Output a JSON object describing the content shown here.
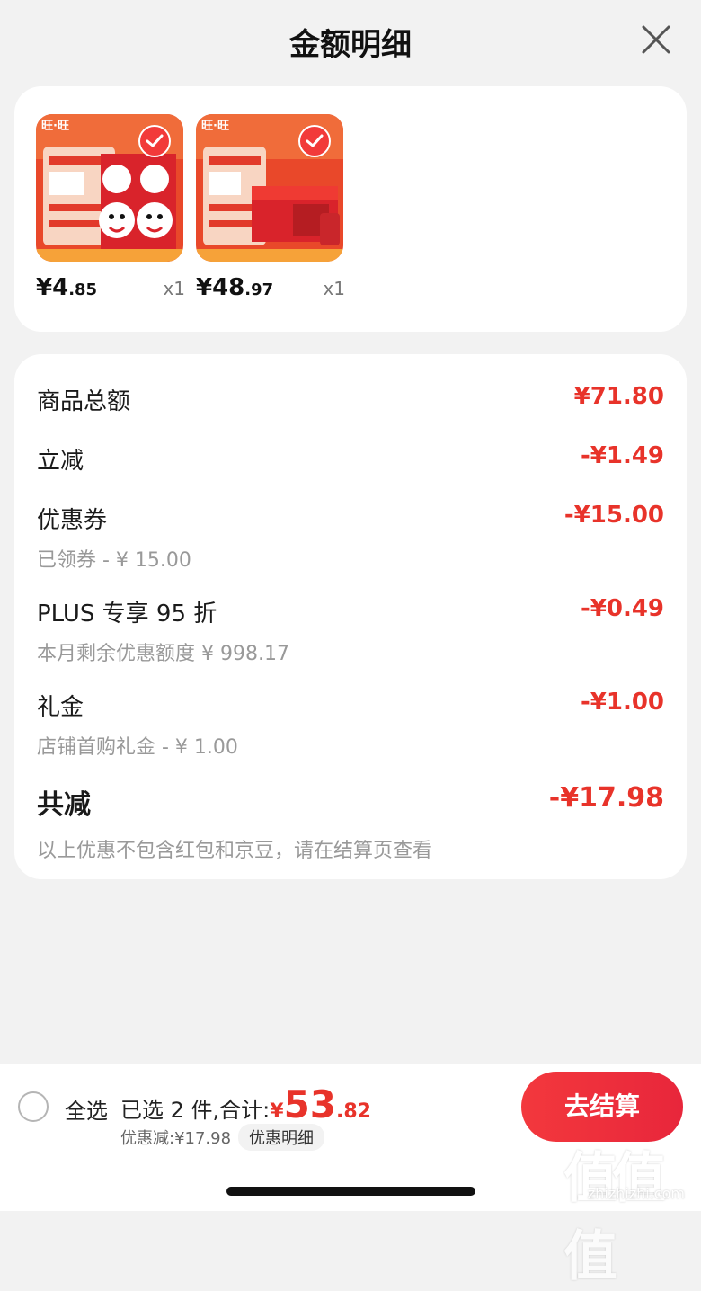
{
  "header": {
    "title": "金额明细",
    "close_icon": "close-icon"
  },
  "products": [
    {
      "price_int": "¥4",
      "price_dec": ".85",
      "qty": "x1",
      "image_text": "旺·旺",
      "selected": true
    },
    {
      "price_int": "¥48",
      "price_dec": ".97",
      "qty": "x1",
      "image_text": "旺·旺",
      "selected": true
    }
  ],
  "detail": {
    "rows": [
      {
        "label": "商品总额",
        "value": "¥71.80",
        "sub": ""
      },
      {
        "label": "立减",
        "value": "-¥1.49",
        "sub": ""
      },
      {
        "label": "优惠券",
        "value": "-¥15.00",
        "sub": "已领券 - ¥ 15.00"
      },
      {
        "label": "PLUS 专享 95 折",
        "value": "-¥0.49",
        "sub": "本月剩余优惠额度 ¥ 998.17"
      },
      {
        "label": "礼金",
        "value": "-¥1.00",
        "sub": "店铺首购礼金 - ¥ 1.00"
      }
    ],
    "total": {
      "label": "共减",
      "value": "-¥17.98",
      "note": "以上优惠不包含红包和京豆，请在结算页查看"
    }
  },
  "bottom_bar": {
    "select_all": "全选",
    "selected_text": "已选 2 件,合计:",
    "currency": "¥",
    "total_int": "53",
    "total_dec": ".82",
    "discount_text": "优惠减:¥17.98",
    "detail_chip": "优惠明细",
    "checkout_label": "去结算"
  },
  "watermark": {
    "mark": "值值值",
    "url": "zhizhizhi.com"
  },
  "colors": {
    "accent": "#e8332a",
    "background": "#f2f2f2",
    "card": "#ffffff"
  }
}
